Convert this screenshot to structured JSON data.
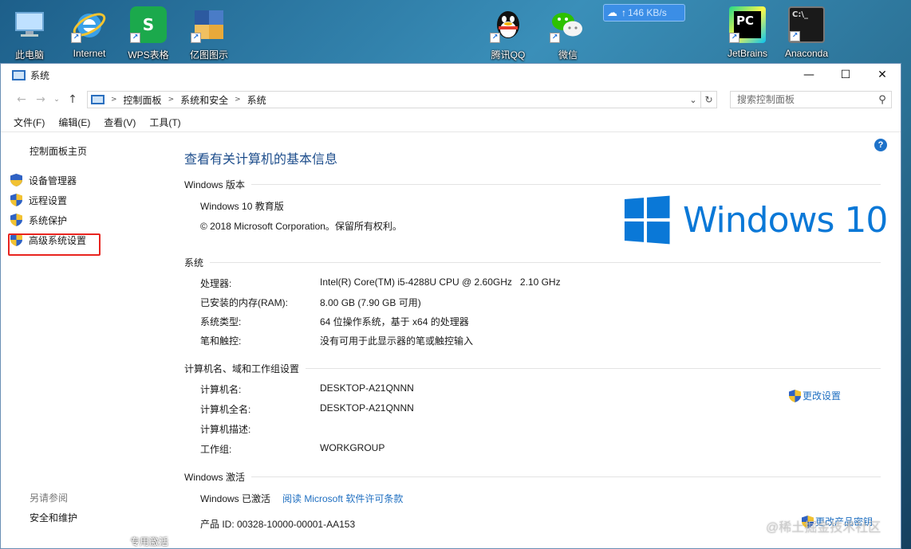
{
  "desktop": {
    "icons": [
      {
        "label": "此电脑",
        "icon": "computer-icon"
      },
      {
        "label": "Internet",
        "icon": "internet-explorer-icon"
      },
      {
        "label": "WPS表格",
        "icon": "wps-spreadsheet-icon"
      },
      {
        "label": "亿图图示",
        "icon": "edraw-icon"
      },
      {
        "label": "腾讯QQ",
        "icon": "qq-icon"
      },
      {
        "label": "微信",
        "icon": "wechat-icon"
      },
      {
        "label": "JetBrains",
        "icon": "pycharm-icon"
      },
      {
        "label": "Anaconda",
        "icon": "terminal-icon"
      }
    ],
    "speed": "146 KB/s",
    "bottom_label": "专用激活"
  },
  "window": {
    "title": "系统",
    "controls": {
      "minimize": "—",
      "maximize": "☐",
      "close": "✕"
    }
  },
  "nav": {
    "back": "←",
    "forward": "→",
    "up": "↑",
    "recent": "⌄",
    "breadcrumbs": [
      "控制面板",
      "系统和安全",
      "系统"
    ],
    "search_placeholder": "搜索控制面板"
  },
  "menu": [
    "文件(F)",
    "编辑(E)",
    "查看(V)",
    "工具(T)"
  ],
  "sidebar": {
    "home": "控制面板主页",
    "items": [
      "设备管理器",
      "远程设置",
      "系统保护",
      "高级系统设置"
    ],
    "see_also_title": "另请参阅",
    "see_also": [
      "安全和维护"
    ]
  },
  "main": {
    "title": "查看有关计算机的基本信息",
    "edition": {
      "heading": "Windows 版本",
      "name": "Windows 10 教育版",
      "copyright": "© 2018 Microsoft Corporation。保留所有权利。",
      "logo_text": "Windows 10"
    },
    "system": {
      "heading": "系统",
      "rows": [
        {
          "label": "处理器:",
          "value": "Intel(R) Core(TM) i5-4288U CPU @ 2.60GHz   2.10 GHz"
        },
        {
          "label": "已安装的内存(RAM):",
          "value": "8.00 GB (7.90 GB 可用)"
        },
        {
          "label": "系统类型:",
          "value": "64 位操作系统，基于 x64 的处理器"
        },
        {
          "label": "笔和触控:",
          "value": "没有可用于此显示器的笔或触控输入"
        }
      ]
    },
    "computer": {
      "heading": "计算机名、域和工作组设置",
      "rows": [
        {
          "label": "计算机名:",
          "value": "DESKTOP-A21QNNN"
        },
        {
          "label": "计算机全名:",
          "value": "DESKTOP-A21QNNN"
        },
        {
          "label": "计算机描述:",
          "value": ""
        },
        {
          "label": "工作组:",
          "value": "WORKGROUP"
        }
      ],
      "change_link": "更改设置"
    },
    "activation": {
      "heading": "Windows 激活",
      "status": "Windows 已激活",
      "license_link": "阅读 Microsoft 软件许可条款",
      "product_id": "产品 ID: 00328-10000-00001-AA153",
      "change_key": "更改产品密钥"
    }
  },
  "watermark": "@稀土掘金技术社区",
  "colors": {
    "accent": "#1f6fc1",
    "title": "#1e4e8c",
    "windows_blue": "#0a78d7",
    "highlight": "#e8241f"
  }
}
